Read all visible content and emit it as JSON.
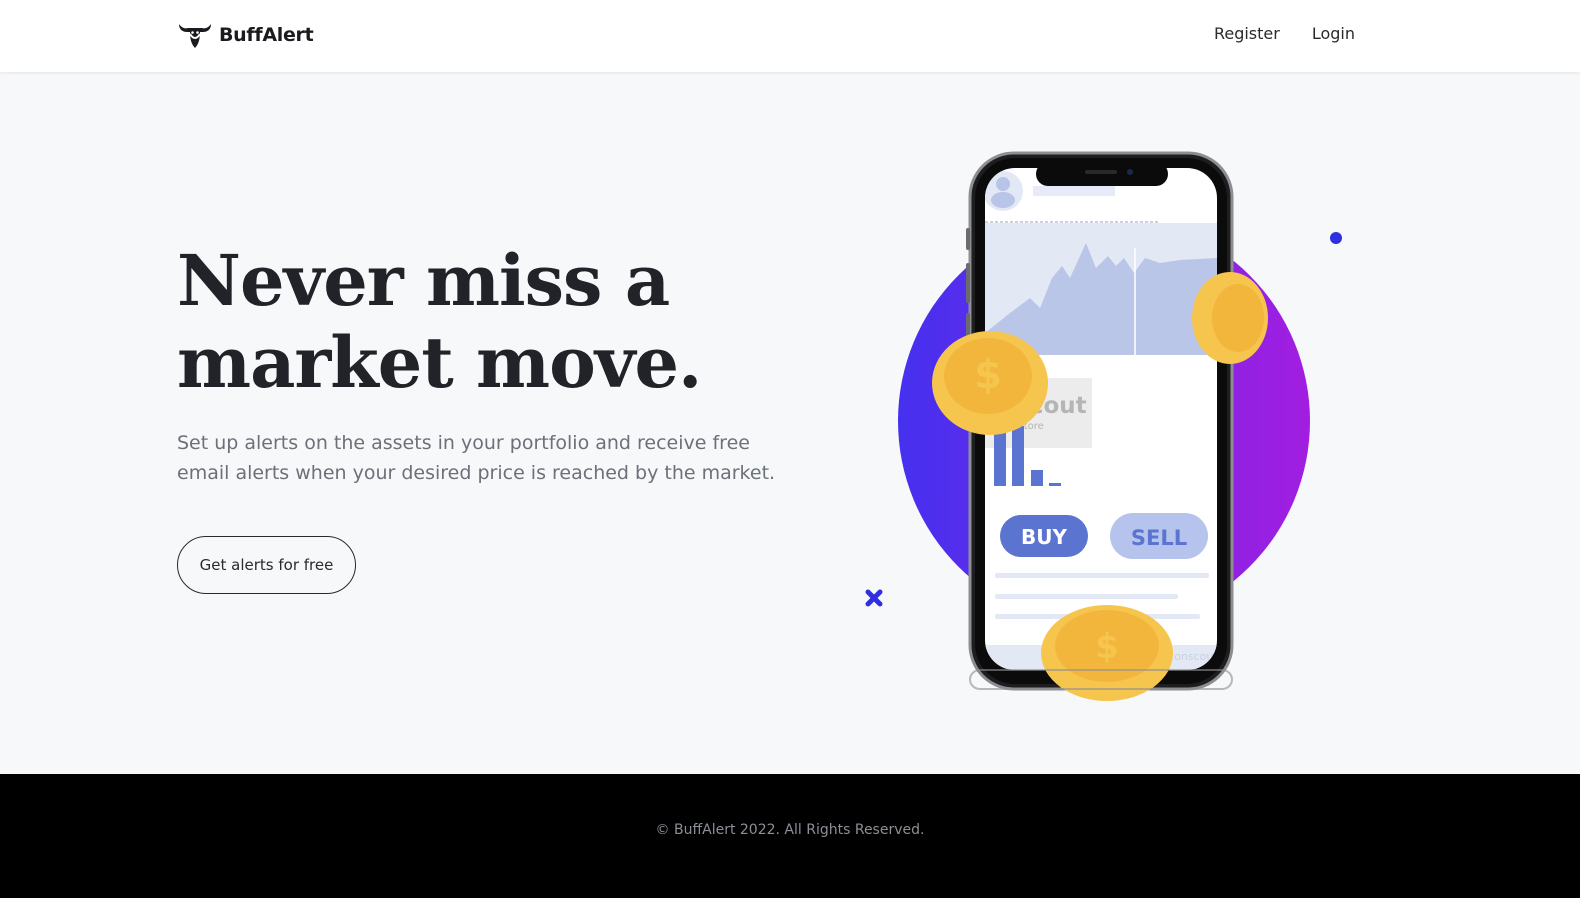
{
  "navbar": {
    "brand_name": "BuffAlert",
    "brand_icon": "bull-head-icon",
    "links": [
      {
        "label": "Register"
      },
      {
        "label": "Login"
      }
    ]
  },
  "hero": {
    "title_line1": "Never miss a",
    "title_line2": "market move.",
    "subtitle": "Set up alerts on the assets in your portfolio and receive free email alerts when your desired price is reached by the market.",
    "cta_label": "Get alerts for free"
  },
  "illustration": {
    "buy_label": "BUY",
    "sell_label": "SELL",
    "watermark": "onscout",
    "watermark_sub": "Scout Store",
    "corner_watermark": "iconscout",
    "colors": {
      "circle_start": "#4630ef",
      "circle_end": "#a21ee0",
      "buy": "#5a74cf",
      "sell": "#b6c3ec",
      "coin": "#f2b63c",
      "chart_area": "#b9c6e8",
      "accent_dot": "#2f2fe0"
    }
  },
  "footer": {
    "copyright": "© BuffAlert 2022. All Rights Reserved."
  }
}
